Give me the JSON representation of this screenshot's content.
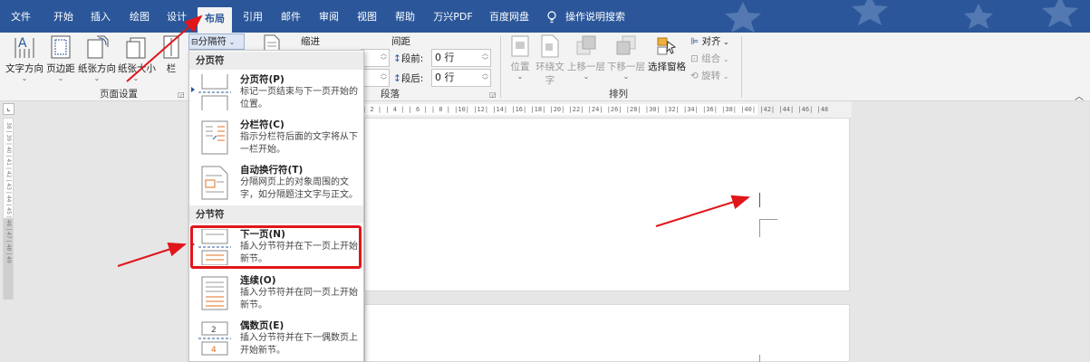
{
  "menu": {
    "tabs": [
      "文件",
      "开始",
      "插入",
      "绘图",
      "设计",
      "布局",
      "引用",
      "邮件",
      "审阅",
      "视图",
      "帮助",
      "万兴PDF",
      "百度网盘"
    ],
    "active": "布局",
    "tell_me": "操作说明搜索"
  },
  "ribbon": {
    "page_setup": {
      "buttons": [
        "文字方向",
        "页边距",
        "纸张方向",
        "纸张大小",
        "栏"
      ],
      "group_label": "页面设置"
    },
    "breaks_button": "分隔符",
    "indent_label": "缩进",
    "spacing_label": "间距",
    "spacing_before_label": "段前:",
    "spacing_before_value": "0 行",
    "spacing_after_label": "段后:",
    "spacing_after_value": "0 行",
    "paragraph_group_label": "段落",
    "arrange": {
      "position": "位置",
      "wrap_text_1": "环绕文",
      "wrap_text_2": "字",
      "bring_forward": "上移一层",
      "send_backward": "下移一层",
      "selection_pane": "选择窗格",
      "align": "对齐",
      "group": "组合",
      "rotate": "旋转",
      "group_label": "排列"
    }
  },
  "ruler": {
    "horizontal": "| 2 |  | 4 |  | 6 |  | 8 |  |10|  |12|  |14|  |16|  |18|  |20|  |22|  |24|  |26|  |28|  |30|  |32|  |34|  |36|  |38|  |40|  |42|  |44|  |46|  |48",
    "vertical": "38 | 39 | 40 | 41 | 42 | 43 | 44 | 45 | 46 | 47 | 48 | 49"
  },
  "breaks_menu": {
    "page_breaks_header": "分页符",
    "section_breaks_header": "分节符",
    "items": [
      {
        "title": "分页符(P)",
        "desc": "标记一页结束与下一页开始的位置。"
      },
      {
        "title": "分栏符(C)",
        "desc": "指示分栏符后面的文字将从下一栏开始。"
      },
      {
        "title": "自动换行符(T)",
        "desc": "分隔网页上的对象周围的文字，如分隔题注文字与正文。"
      },
      {
        "title": "下一页(N)",
        "desc": "插入分节符并在下一页上开始新节。"
      },
      {
        "title": "连续(O)",
        "desc": "插入分节符并在同一页上开始新节。"
      },
      {
        "title": "偶数页(E)",
        "desc": "插入分节符并在下一偶数页上开始新节。"
      }
    ]
  },
  "colors": {
    "accent": "#2b579a",
    "highlight": "#e0161b"
  }
}
